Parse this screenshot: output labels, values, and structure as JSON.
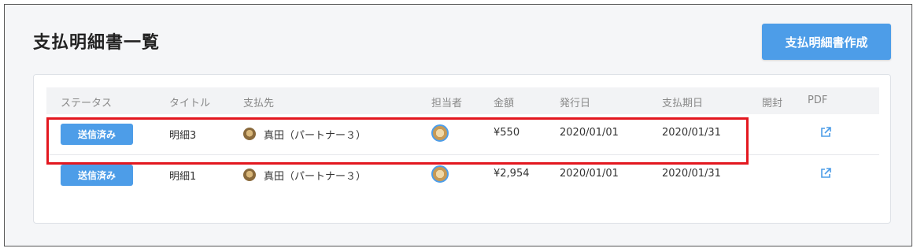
{
  "page": {
    "title": "支払明細書一覧"
  },
  "toolbar": {
    "create_label": "支払明細書作成"
  },
  "table": {
    "headers": {
      "status": "ステータス",
      "title": "タイトル",
      "payee": "支払先",
      "staff": "担当者",
      "amount": "金額",
      "issue_date": "発行日",
      "due_date": "支払期日",
      "opened": "開封",
      "pdf": "PDF"
    },
    "rows": [
      {
        "status": "送信済み",
        "title": "明細3",
        "payee": "真田（パートナー３）",
        "amount": "¥550",
        "issue_date": "2020/01/01",
        "due_date": "2020/01/31",
        "opened": ""
      },
      {
        "status": "送信済み",
        "title": "明細1",
        "payee": "真田（パートナー３）",
        "amount": "¥2,954",
        "issue_date": "2020/01/01",
        "due_date": "2020/01/31",
        "opened": ""
      }
    ]
  },
  "colors": {
    "accent": "#4d9de8",
    "highlight": "#e3171f"
  },
  "icons": {
    "pdf_link": "external-link-icon",
    "avatar": "avatar-icon"
  }
}
